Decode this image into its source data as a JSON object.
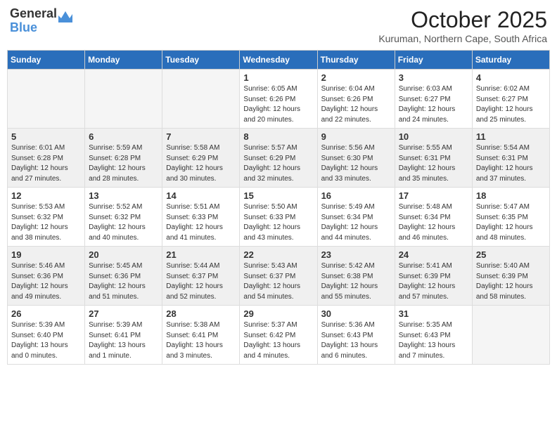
{
  "logo": {
    "general": "General",
    "blue": "Blue"
  },
  "title": "October 2025",
  "subtitle": "Kuruman, Northern Cape, South Africa",
  "weekdays": [
    "Sunday",
    "Monday",
    "Tuesday",
    "Wednesday",
    "Thursday",
    "Friday",
    "Saturday"
  ],
  "weeks": [
    [
      {
        "day": "",
        "info": ""
      },
      {
        "day": "",
        "info": ""
      },
      {
        "day": "",
        "info": ""
      },
      {
        "day": "1",
        "info": "Sunrise: 6:05 AM\nSunset: 6:26 PM\nDaylight: 12 hours\nand 20 minutes."
      },
      {
        "day": "2",
        "info": "Sunrise: 6:04 AM\nSunset: 6:26 PM\nDaylight: 12 hours\nand 22 minutes."
      },
      {
        "day": "3",
        "info": "Sunrise: 6:03 AM\nSunset: 6:27 PM\nDaylight: 12 hours\nand 24 minutes."
      },
      {
        "day": "4",
        "info": "Sunrise: 6:02 AM\nSunset: 6:27 PM\nDaylight: 12 hours\nand 25 minutes."
      }
    ],
    [
      {
        "day": "5",
        "info": "Sunrise: 6:01 AM\nSunset: 6:28 PM\nDaylight: 12 hours\nand 27 minutes."
      },
      {
        "day": "6",
        "info": "Sunrise: 5:59 AM\nSunset: 6:28 PM\nDaylight: 12 hours\nand 28 minutes."
      },
      {
        "day": "7",
        "info": "Sunrise: 5:58 AM\nSunset: 6:29 PM\nDaylight: 12 hours\nand 30 minutes."
      },
      {
        "day": "8",
        "info": "Sunrise: 5:57 AM\nSunset: 6:29 PM\nDaylight: 12 hours\nand 32 minutes."
      },
      {
        "day": "9",
        "info": "Sunrise: 5:56 AM\nSunset: 6:30 PM\nDaylight: 12 hours\nand 33 minutes."
      },
      {
        "day": "10",
        "info": "Sunrise: 5:55 AM\nSunset: 6:31 PM\nDaylight: 12 hours\nand 35 minutes."
      },
      {
        "day": "11",
        "info": "Sunrise: 5:54 AM\nSunset: 6:31 PM\nDaylight: 12 hours\nand 37 minutes."
      }
    ],
    [
      {
        "day": "12",
        "info": "Sunrise: 5:53 AM\nSunset: 6:32 PM\nDaylight: 12 hours\nand 38 minutes."
      },
      {
        "day": "13",
        "info": "Sunrise: 5:52 AM\nSunset: 6:32 PM\nDaylight: 12 hours\nand 40 minutes."
      },
      {
        "day": "14",
        "info": "Sunrise: 5:51 AM\nSunset: 6:33 PM\nDaylight: 12 hours\nand 41 minutes."
      },
      {
        "day": "15",
        "info": "Sunrise: 5:50 AM\nSunset: 6:33 PM\nDaylight: 12 hours\nand 43 minutes."
      },
      {
        "day": "16",
        "info": "Sunrise: 5:49 AM\nSunset: 6:34 PM\nDaylight: 12 hours\nand 44 minutes."
      },
      {
        "day": "17",
        "info": "Sunrise: 5:48 AM\nSunset: 6:34 PM\nDaylight: 12 hours\nand 46 minutes."
      },
      {
        "day": "18",
        "info": "Sunrise: 5:47 AM\nSunset: 6:35 PM\nDaylight: 12 hours\nand 48 minutes."
      }
    ],
    [
      {
        "day": "19",
        "info": "Sunrise: 5:46 AM\nSunset: 6:36 PM\nDaylight: 12 hours\nand 49 minutes."
      },
      {
        "day": "20",
        "info": "Sunrise: 5:45 AM\nSunset: 6:36 PM\nDaylight: 12 hours\nand 51 minutes."
      },
      {
        "day": "21",
        "info": "Sunrise: 5:44 AM\nSunset: 6:37 PM\nDaylight: 12 hours\nand 52 minutes."
      },
      {
        "day": "22",
        "info": "Sunrise: 5:43 AM\nSunset: 6:37 PM\nDaylight: 12 hours\nand 54 minutes."
      },
      {
        "day": "23",
        "info": "Sunrise: 5:42 AM\nSunset: 6:38 PM\nDaylight: 12 hours\nand 55 minutes."
      },
      {
        "day": "24",
        "info": "Sunrise: 5:41 AM\nSunset: 6:39 PM\nDaylight: 12 hours\nand 57 minutes."
      },
      {
        "day": "25",
        "info": "Sunrise: 5:40 AM\nSunset: 6:39 PM\nDaylight: 12 hours\nand 58 minutes."
      }
    ],
    [
      {
        "day": "26",
        "info": "Sunrise: 5:39 AM\nSunset: 6:40 PM\nDaylight: 13 hours\nand 0 minutes."
      },
      {
        "day": "27",
        "info": "Sunrise: 5:39 AM\nSunset: 6:41 PM\nDaylight: 13 hours\nand 1 minute."
      },
      {
        "day": "28",
        "info": "Sunrise: 5:38 AM\nSunset: 6:41 PM\nDaylight: 13 hours\nand 3 minutes."
      },
      {
        "day": "29",
        "info": "Sunrise: 5:37 AM\nSunset: 6:42 PM\nDaylight: 13 hours\nand 4 minutes."
      },
      {
        "day": "30",
        "info": "Sunrise: 5:36 AM\nSunset: 6:43 PM\nDaylight: 13 hours\nand 6 minutes."
      },
      {
        "day": "31",
        "info": "Sunrise: 5:35 AM\nSunset: 6:43 PM\nDaylight: 13 hours\nand 7 minutes."
      },
      {
        "day": "",
        "info": ""
      }
    ]
  ]
}
